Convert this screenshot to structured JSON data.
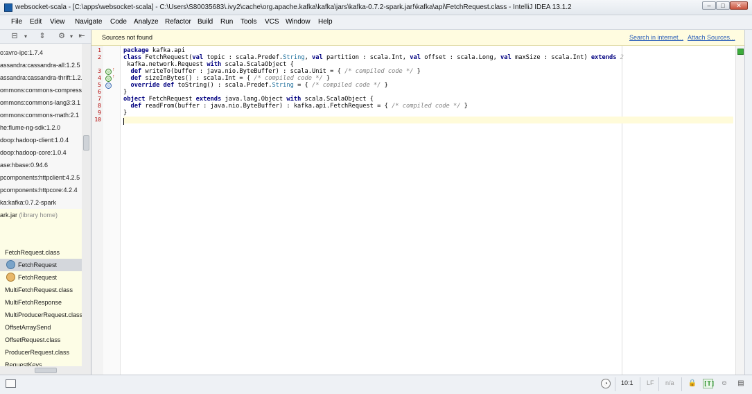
{
  "window": {
    "title": "websocket-scala - [C:\\apps\\websocket-scala] - C:\\Users\\S80035683\\.ivy2\\cache\\org.apache.kafka\\kafka\\jars\\kafka-0.7.2-spark.jar!\\kafka\\api\\FetchRequest.class - IntelliJ IDEA 13.1.2",
    "min_glyph": "–",
    "max_glyph": "□",
    "close_glyph": "✕"
  },
  "menu": [
    "File",
    "Edit",
    "View",
    "Navigate",
    "Code",
    "Analyze",
    "Refactor",
    "Build",
    "Run",
    "Tools",
    "VCS",
    "Window",
    "Help"
  ],
  "project_tree": {
    "items": [
      {
        "label": "o:avro-ipc:1.7.4"
      },
      {
        "label": "assandra:cassandra-all:1.2.5"
      },
      {
        "label": "assandra:cassandra-thrift:1.2.5"
      },
      {
        "label": "ommons:commons-compress:1"
      },
      {
        "label": "ommons:commons-lang3:3.1"
      },
      {
        "label": "ommons:commons-math:2.1"
      },
      {
        "label": "he:flume-ng-sdk:1.2.0"
      },
      {
        "label": "doop:hadoop-client:1.0.4"
      },
      {
        "label": "doop:hadoop-core:1.0.4"
      },
      {
        "label": "ase:hbase:0.94.6"
      },
      {
        "label": "pcomponents:httpclient:4.2.5"
      },
      {
        "label": "pcomponents:httpcore:4.2.4"
      },
      {
        "label": "ka:kafka:0.7.2-spark"
      },
      {
        "label": "ark.jar",
        "muted": "(library home)"
      },
      {
        "label": ""
      },
      {
        "label": ""
      },
      {
        "label": "FetchRequest.class"
      },
      {
        "label": "FetchRequest",
        "icon": "class-icon"
      },
      {
        "label": "FetchRequest",
        "icon": "object-icon"
      },
      {
        "label": "MultiFetchRequest.class"
      },
      {
        "label": "MultiFetchResponse"
      },
      {
        "label": "MultiProducerRequest.class"
      },
      {
        "label": "OffsetArraySend"
      },
      {
        "label": "OffsetRequest.class"
      },
      {
        "label": "ProducerRequest.class"
      },
      {
        "label": "RequestKeys"
      }
    ]
  },
  "notification": {
    "message": "Sources not found",
    "search_link": "Search in internet...",
    "attach_link": "Attach Sources..."
  },
  "editor": {
    "line_numbers": [
      "1",
      "2",
      "3",
      "4",
      "5",
      "6",
      "7",
      "8",
      "9",
      "10"
    ],
    "code": {
      "l1_kw": "package",
      "l1_rest": " kafka.api",
      "l2_a": "class",
      "l2_b": " FetchRequest(",
      "l2_c": "val",
      "l2_d": " topic : scala.Predef.",
      "l2_e": "String",
      "l2_f": ", ",
      "l2_g": "val",
      "l2_h": " partition : scala.Int, ",
      "l2_i": "val",
      "l2_j": " offset : scala.Long, ",
      "l2_k": "val",
      "l2_l": " maxSize : scala.Int) ",
      "l2_m": "extends",
      "l2_hint": " 2",
      "l3_a": " kafka.network.Request ",
      "l3_b": "with",
      "l3_c": " scala.ScalaObject {",
      "l4_a": "  def",
      "l4_b": " writeTo(buffer : java.nio.ByteBuffer) : scala.Unit = { ",
      "l4_c": "/* compiled code */",
      "l4_d": " }",
      "l5_a": "  def",
      "l5_b": " sizeInBytes() : scala.Int = { ",
      "l5_c": "/* compiled code */",
      "l5_d": " }",
      "l6_a": "  override def",
      "l6_b": " toString() : scala.Predef.",
      "l6_c": "String",
      "l6_d": " = { ",
      "l6_e": "/* compiled code */",
      "l6_f": " }",
      "l7": "}",
      "l8_a": "object",
      "l8_b": " FetchRequest ",
      "l8_c": "extends",
      "l8_d": " java.lang.Object ",
      "l8_e": "with",
      "l8_f": " scala.ScalaObject {",
      "l9_a": "  def",
      "l9_b": " readFrom(buffer : java.nio.ByteBuffer) : kafka.api.FetchRequest = { ",
      "l9_c": "/* compiled code */",
      "l9_d": " }",
      "l10": "}"
    }
  },
  "status": {
    "position": "10:1",
    "line_sep": "LF",
    "encoding": "n/a",
    "inspector": "[T]"
  },
  "colors": {
    "keyword": "#000080",
    "type": "#1d6f9c",
    "comment": "#808080",
    "line_number": "#b30000",
    "notification_bg": "#fffce0",
    "current_line": "#fffbd9"
  }
}
